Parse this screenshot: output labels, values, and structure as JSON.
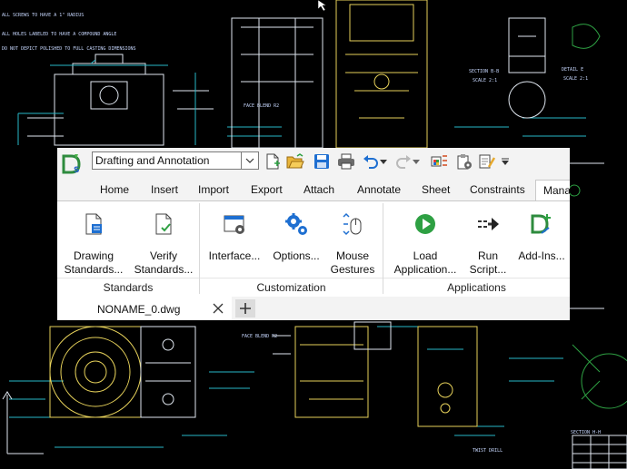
{
  "quick_access": {
    "workspace_value": "Drafting and Annotation"
  },
  "tabs": [
    "Home",
    "Insert",
    "Import",
    "Export",
    "Attach",
    "Annotate",
    "Sheet",
    "Constraints"
  ],
  "active_tab": "Mana",
  "panel": {
    "buttons": [
      {
        "line1": "Drawing",
        "line2": "Standards..."
      },
      {
        "line1": "Verify",
        "line2": "Standards..."
      },
      {
        "line1": "Interface...",
        "line2": ""
      },
      {
        "line1": "Options...",
        "line2": ""
      },
      {
        "line1": "Mouse",
        "line2": "Gestures"
      },
      {
        "line1": "Load",
        "line2": "Application..."
      },
      {
        "line1": "Run",
        "line2": "Script..."
      },
      {
        "line1": "Add-Ins...",
        "line2": ""
      }
    ],
    "groups": [
      "Standards",
      "Customization",
      "Applications"
    ]
  },
  "document": {
    "tab_label": "NONAME_0.dwg"
  },
  "colors": {
    "accent_blue": "#1e6fd1",
    "green": "#2ea043",
    "cad_yellow": "#e6d15a",
    "cad_cyan": "#27b9c9",
    "cad_white": "#dfe6ef"
  },
  "drawing_notes": {
    "note1": "ALL SCREWS TO HAVE A 1\" RADIUS",
    "note2": "ALL HOLES LABELED TO HAVE A COMPOUND ANGLE",
    "note3": "DO NOT DEPICT POLISHED TO FULL CASTING DIMENSIONS",
    "section_bb": "SECTION B-B",
    "scale_bb": "SCALE 2:1",
    "detail_e": "DETAIL E",
    "scale_e": "SCALE 2:1",
    "section_h": "SECTION H-H",
    "face_blend_r1": "FACE BLEND R2",
    "face_blend_r2": "FACE BLEND R2",
    "twist_drill": "TWIST DRILL"
  }
}
